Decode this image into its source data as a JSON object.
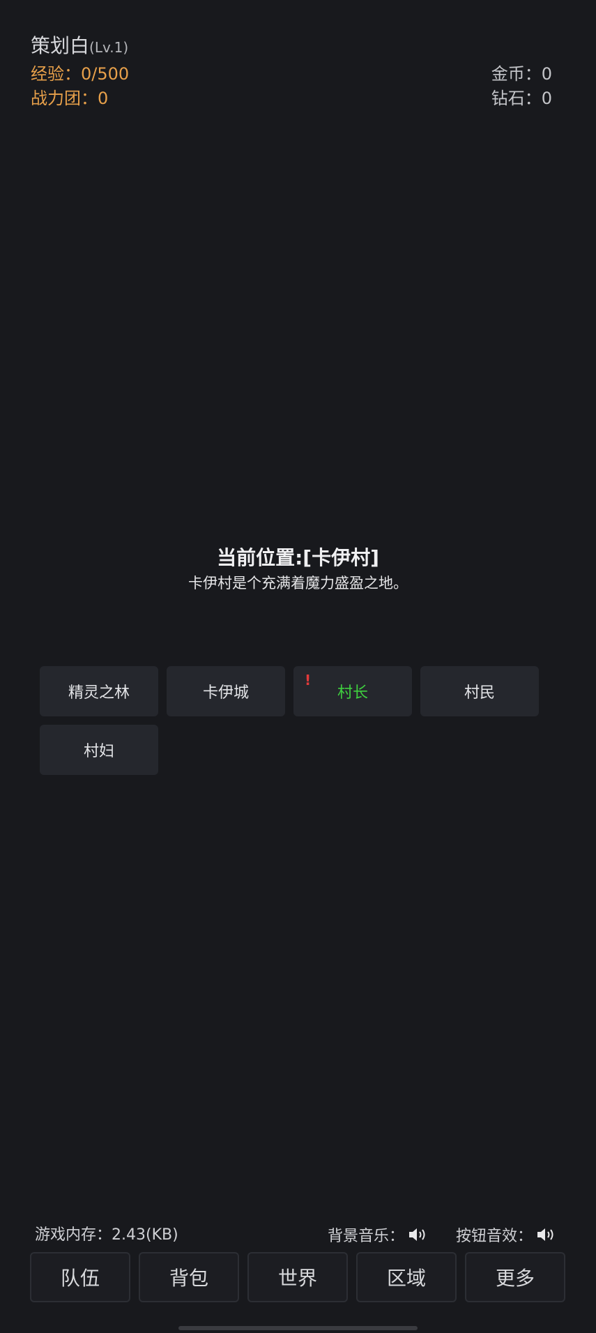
{
  "player": {
    "name": "策划白",
    "level": "(Lv.1)",
    "exp_label": "经验：",
    "exp_value": "0/500",
    "power_label": "战力团：",
    "power_value": "0",
    "gold_label": "金币：",
    "gold_value": "0",
    "diamond_label": "钻石：",
    "diamond_value": "0"
  },
  "location": {
    "title": "当前位置:[卡伊村]",
    "description": "卡伊村是个充满着魔力盛盈之地。"
  },
  "npcs": [
    {
      "label": "精灵之林",
      "has_alert": false
    },
    {
      "label": "卡伊城",
      "has_alert": false
    },
    {
      "label": "村长",
      "has_alert": true,
      "alert": "!"
    },
    {
      "label": "村民",
      "has_alert": false
    },
    {
      "label": "村妇",
      "has_alert": false
    }
  ],
  "footer": {
    "memory": "游戏内存：2.43(KB)",
    "bgm_label": "背景音乐：",
    "sfx_label": "按钮音效：",
    "bgm_icon": "speaker-icon",
    "sfx_icon": "speaker-icon"
  },
  "nav": [
    "队伍",
    "背包",
    "世界",
    "区域",
    "更多"
  ],
  "colors": {
    "background": "#18191d",
    "accent_orange": "#e7a04a",
    "quest_green": "#3fcf3f",
    "alert_red": "#e23a3a"
  }
}
